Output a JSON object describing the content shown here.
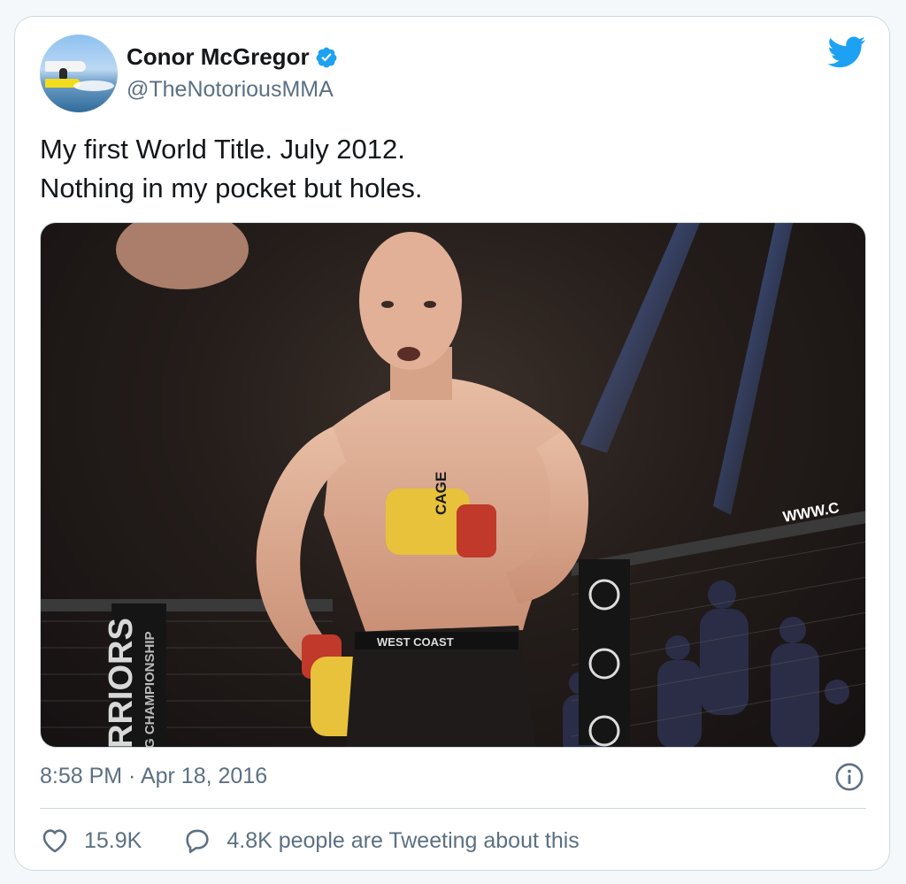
{
  "tweet": {
    "author": {
      "display_name": "Conor McGregor",
      "handle": "@TheNotoriousMMA",
      "verified": true,
      "avatar_icon": "avatar-jetski-photo"
    },
    "text": "My first World Title. July 2012.\nNothing in my pocket but holes.",
    "media": {
      "icon": "fighter-in-cage-photo",
      "glove_brand_text": "CAGE",
      "shorts_waistband_text": "WEST COAST",
      "cage_banner_text": "RRIORS",
      "cage_banner_subtext": "G CHAMPIONSHIP",
      "cage_top_text": "WWW.C"
    },
    "timestamp": "8:58 PM · Apr 18, 2016",
    "likes_count": "15.9K",
    "reply_text": "4.8K people are Tweeting about this",
    "icons": {
      "brand": "twitter-bird-icon",
      "verified": "verified-badge-icon",
      "info": "info-icon",
      "like": "heart-icon",
      "reply": "speech-bubble-icon"
    },
    "colors": {
      "brand_blue": "#1da1f2",
      "text_primary": "#14171a",
      "text_secondary": "#5b7083",
      "border": "#cfd9de"
    }
  }
}
